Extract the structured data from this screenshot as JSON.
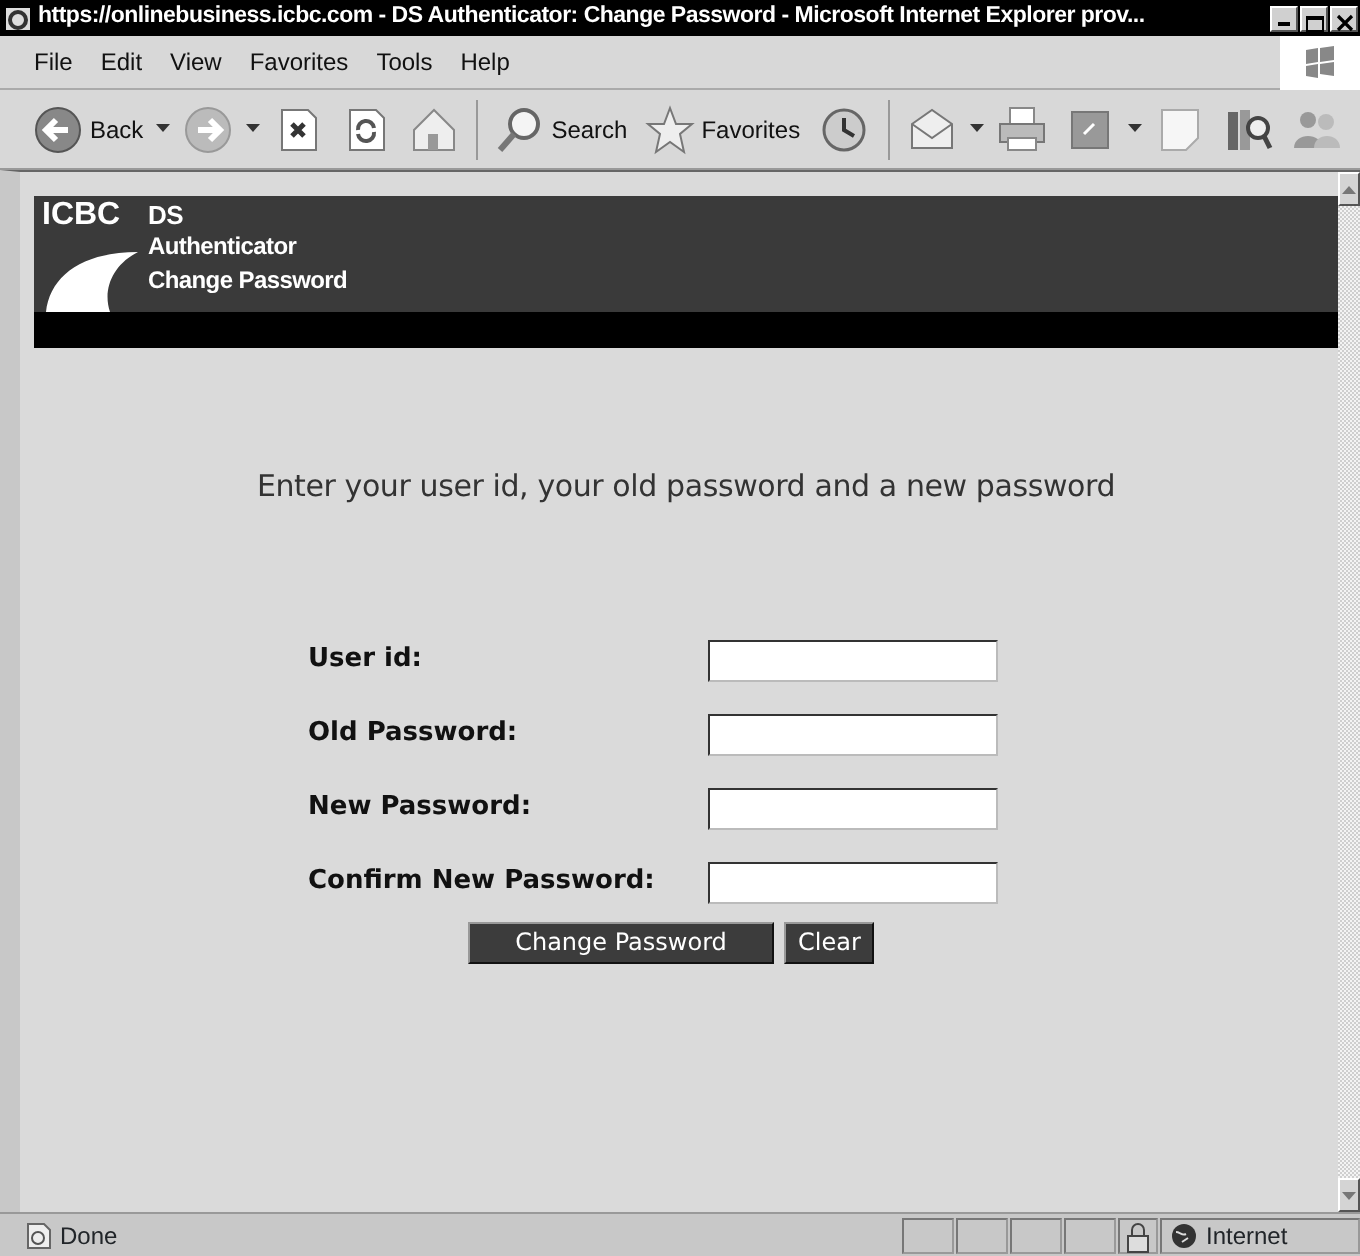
{
  "window": {
    "title": "https://onlinebusiness.icbc.com - DS Authenticator: Change Password - Microsoft Internet Explorer prov..."
  },
  "menu": [
    "File",
    "Edit",
    "View",
    "Favorites",
    "Tools",
    "Help"
  ],
  "toolbar": [
    {
      "kind": "back",
      "label": "Back",
      "dropdown": true
    },
    {
      "kind": "forward",
      "dropdown": true
    },
    {
      "kind": "stop",
      "dropdown": false
    },
    {
      "kind": "refresh",
      "dropdown": false
    },
    {
      "kind": "home",
      "dropdown": false
    },
    {
      "kind": "search",
      "label": "Search",
      "dropdown": false
    },
    {
      "kind": "favorites",
      "label": "Favorites",
      "dropdown": false
    },
    {
      "kind": "history",
      "dropdown": false
    },
    {
      "kind": "mail",
      "dropdown": true
    },
    {
      "kind": "print",
      "dropdown": false
    },
    {
      "kind": "edit",
      "dropdown": true
    },
    {
      "kind": "discuss",
      "dropdown": false
    },
    {
      "kind": "research",
      "dropdown": false
    },
    {
      "kind": "messenger",
      "dropdown": false
    }
  ],
  "header": {
    "logo": "ICBC",
    "lines": [
      "DS",
      "Authenticator",
      "Change Password"
    ]
  },
  "instructions": "Enter your user id, your old password and a new password",
  "fields": [
    {
      "label": "User id:"
    },
    {
      "label": "Old Password:"
    },
    {
      "label": "New Password:"
    },
    {
      "label": "Confirm New Password:"
    }
  ],
  "buttons": [
    "Change Password",
    "Clear"
  ],
  "status_bar": {
    "text": "Done",
    "zone": "Internet"
  }
}
